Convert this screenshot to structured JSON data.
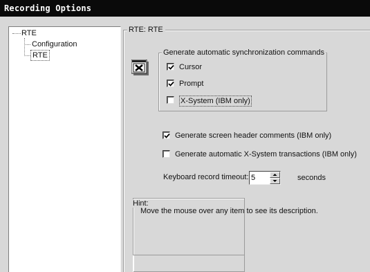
{
  "window": {
    "title": "Recording Options"
  },
  "tree": {
    "root": "RTE",
    "children": [
      "Configuration",
      "RTE"
    ],
    "selected": "RTE"
  },
  "pane": {
    "title": "RTE: RTE",
    "sync_group": {
      "legend": "Generate automatic synchronization commands",
      "options": [
        {
          "label": "Cursor",
          "checked": true
        },
        {
          "label": "Prompt",
          "checked": true
        },
        {
          "label": "X-System (IBM only)",
          "checked": false
        }
      ]
    },
    "screen_header": {
      "label": "Generate screen header comments (IBM only)",
      "checked": true
    },
    "xsystem_tx": {
      "label": "Generate automatic X-System transactions (IBM only)",
      "checked": false
    },
    "timeout": {
      "label": "Keyboard record timeout:",
      "value": "5",
      "unit": "seconds"
    },
    "hint": {
      "legend": "Hint:",
      "text": "Move the mouse over any item to see its description."
    }
  },
  "icons": {
    "window_icon": "x-window-icon"
  }
}
